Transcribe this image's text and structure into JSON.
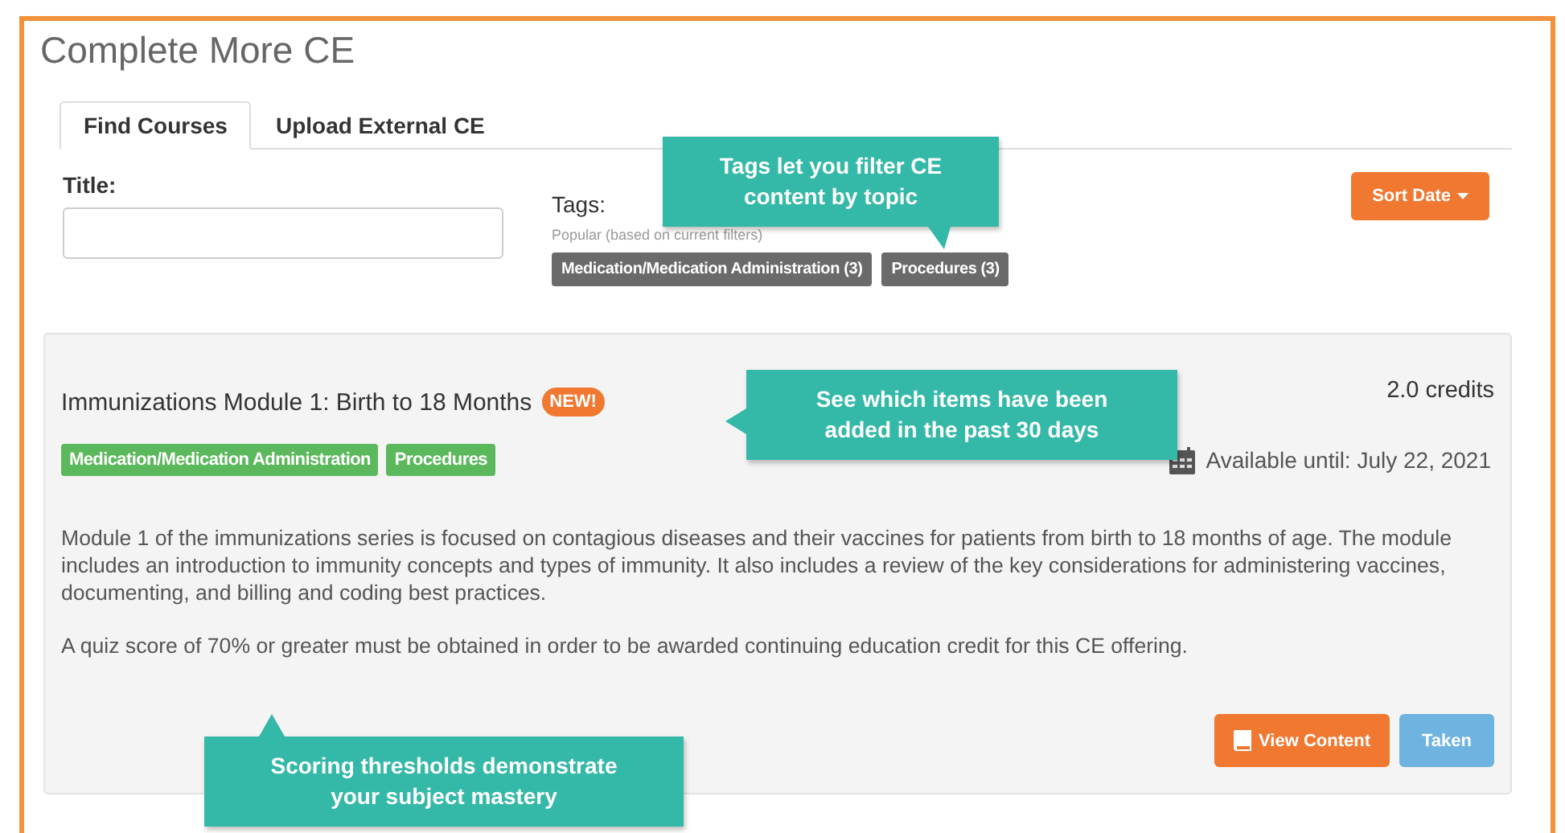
{
  "page": {
    "title": "Complete More CE"
  },
  "tabs": [
    {
      "label": "Find Courses",
      "selected": true
    },
    {
      "label": "Upload External CE",
      "selected": false
    }
  ],
  "filters": {
    "title_label": "Title:",
    "tags_label": "Tags:",
    "tags_hint": "Popular (based on current filters)",
    "popular_tags": [
      "Medication/Medication Administration (3)",
      "Procedures (3)"
    ],
    "sort_button": "Sort Date"
  },
  "course": {
    "title": "Immunizations Module 1: Birth to 18 Months",
    "badge": "NEW!",
    "credits": "2.0 credits",
    "tags": [
      "Medication/Medication Administration",
      "Procedures"
    ],
    "availability": "Available until: July 22, 2021",
    "description": "Module 1 of the immunizations series is focused on contagious diseases and their vaccines for patients from birth to 18 months of age. The module includes an introduction to immunity concepts and types of immunity. It also includes a review of the key considerations for administering vaccines, documenting, and billing and coding best practices.",
    "quiz_note": "A quiz score of 70% or greater must be obtained in order to be awarded continuing education credit for this CE offering.",
    "buttons": [
      {
        "label": "View Content",
        "kind": "primary"
      },
      {
        "label": "Taken",
        "kind": "status"
      }
    ]
  },
  "callouts": [
    {
      "text": "Tags let you filter CE content by topic",
      "kind": "down"
    },
    {
      "text": "See which items have been added in the past 30 days",
      "kind": "left"
    },
    {
      "text": "Scoring thresholds demonstrate your subject mastery",
      "kind": "up"
    }
  ]
}
